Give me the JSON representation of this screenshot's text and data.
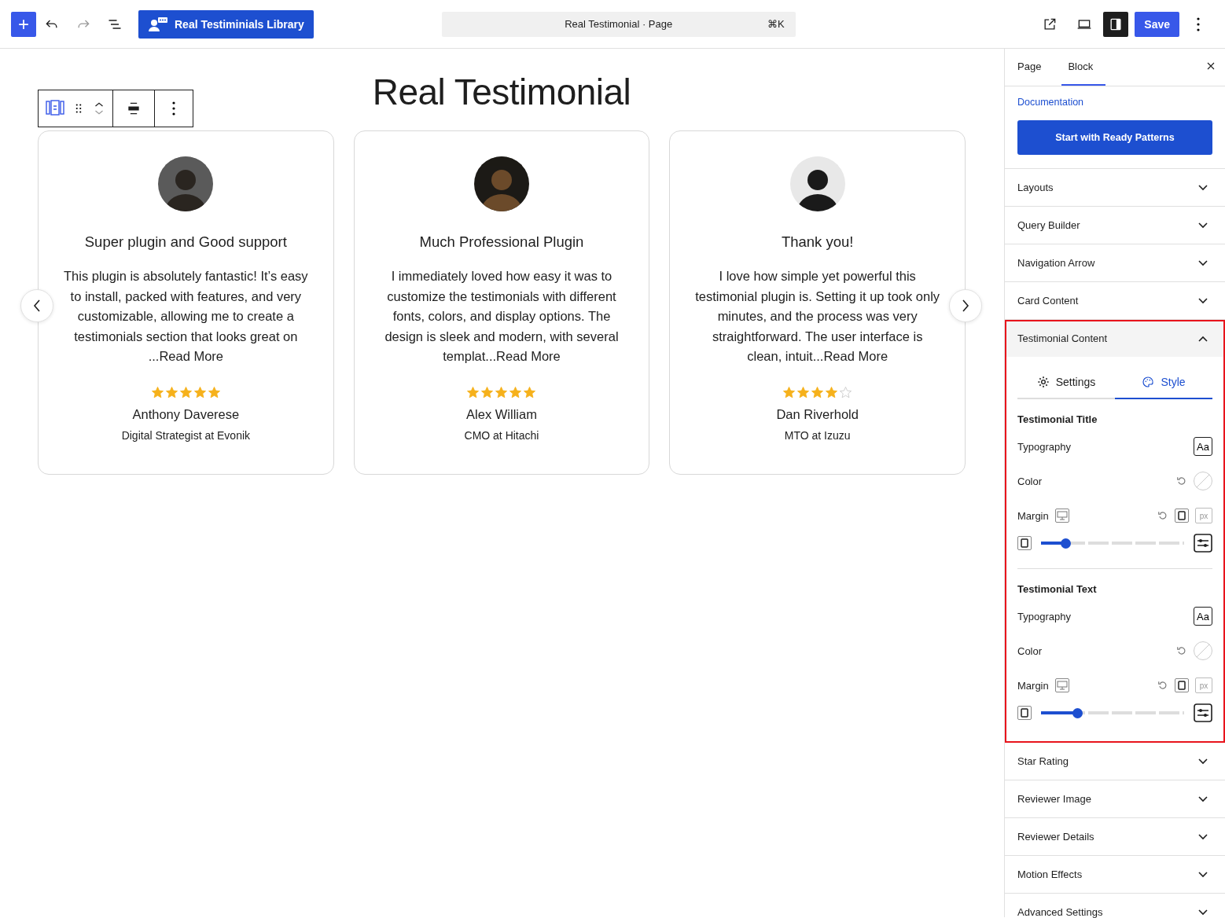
{
  "topbar": {
    "add": "+",
    "library_button": "Real Testiminials Library",
    "command": {
      "title": "Real Testimonial · Page",
      "shortcut": "⌘K"
    },
    "save": "Save"
  },
  "page": {
    "title": "Real Testimonial",
    "cards": [
      {
        "title": "Super plugin and Good support",
        "text": "This plugin is absolutely fantastic! It’s easy to install, packed with features, and very customizable, allowing me to create a testimonials section that looks great on ...Read More",
        "stars": 5,
        "name": "Anthony Daverese",
        "role": "Digital Strategist at Evonik"
      },
      {
        "title": "Much Professional Plugin",
        "text": "I immediately loved how easy it was to customize the testimonials with different fonts, colors, and display options. The design is sleek and modern, with several templat...Read More",
        "stars": 5,
        "name": "Alex William",
        "role": "CMO at Hitachi"
      },
      {
        "title": "Thank you!",
        "text": "I love how simple yet powerful this testimonial plugin is. Setting it up took only minutes, and the process was very straightforward. The user interface is clean, intuit...Read More",
        "stars": 4,
        "name": "Dan Riverhold",
        "role": "MTO at Izuzu"
      }
    ]
  },
  "sidebar": {
    "tabs": [
      {
        "label": "Page",
        "selected": false
      },
      {
        "label": "Block",
        "selected": true
      }
    ],
    "link": "Documentation",
    "patterns_button": "Start with Ready Patterns",
    "panels": [
      {
        "title": "Layouts",
        "expanded": false
      },
      {
        "title": "Query Builder",
        "expanded": false
      },
      {
        "title": "Navigation Arrow",
        "expanded": false
      },
      {
        "title": "Card Content",
        "expanded": false
      },
      {
        "title": "Testimonial Content",
        "expanded": true,
        "highlighted": true,
        "subtabs": [
          {
            "label": "Settings",
            "selected": false
          },
          {
            "label": "Style",
            "selected": true
          }
        ],
        "groups": [
          {
            "title": "Testimonial Title",
            "rows": [
              {
                "kind": "typography",
                "label": "Typography",
                "button": "Aa"
              },
              {
                "kind": "color",
                "label": "Color"
              },
              {
                "kind": "margin",
                "label": "Margin",
                "unit": "px",
                "level": 0.17
              }
            ]
          },
          {
            "title": "Testimonial Text",
            "rows": [
              {
                "kind": "typography",
                "label": "Typography",
                "button": "Aa"
              },
              {
                "kind": "color",
                "label": "Color"
              },
              {
                "kind": "margin",
                "label": "Margin",
                "unit": "px",
                "level": 0.25
              }
            ]
          }
        ]
      },
      {
        "title": "Star Rating",
        "expanded": false
      },
      {
        "title": "Reviewer Image",
        "expanded": false
      },
      {
        "title": "Reviewer Details",
        "expanded": false
      },
      {
        "title": "Motion Effects",
        "expanded": false
      },
      {
        "title": "Advanced Settings",
        "expanded": false
      }
    ]
  }
}
